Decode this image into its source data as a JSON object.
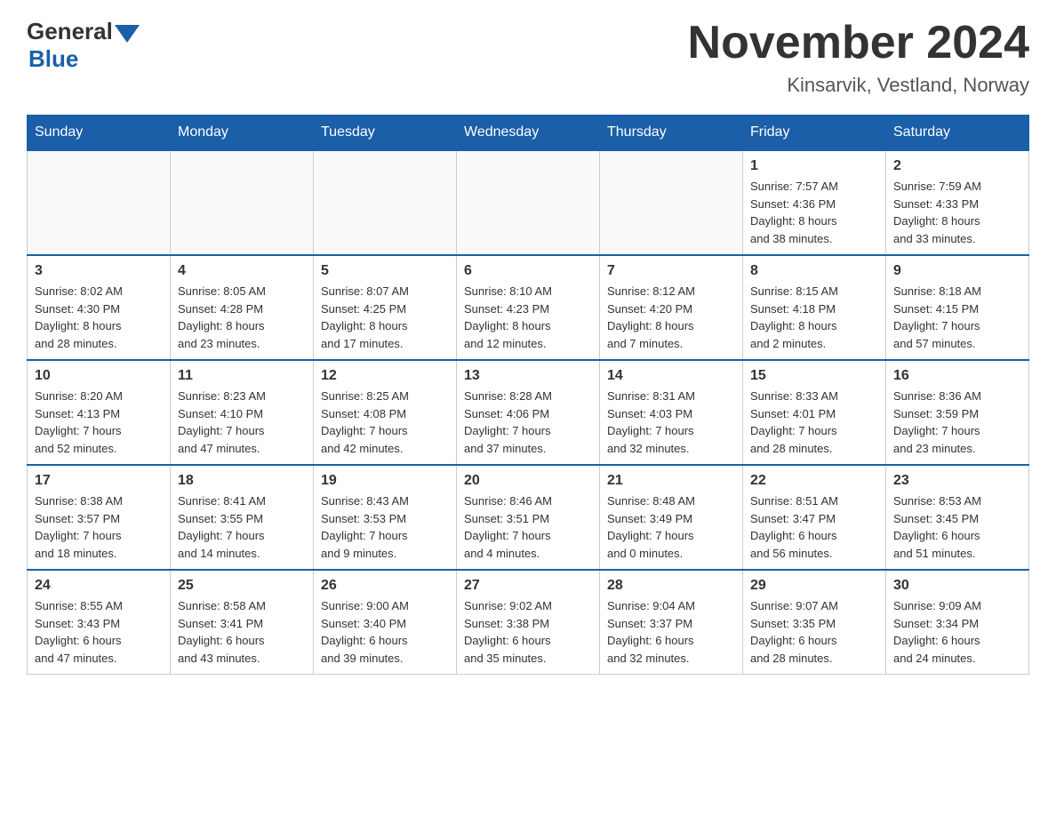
{
  "header": {
    "logo_text_general": "General",
    "logo_text_blue": "Blue",
    "calendar_title": "November 2024",
    "calendar_subtitle": "Kinsarvik, Vestland, Norway"
  },
  "days_of_week": [
    "Sunday",
    "Monday",
    "Tuesday",
    "Wednesday",
    "Thursday",
    "Friday",
    "Saturday"
  ],
  "weeks": [
    [
      {
        "day": "",
        "info": ""
      },
      {
        "day": "",
        "info": ""
      },
      {
        "day": "",
        "info": ""
      },
      {
        "day": "",
        "info": ""
      },
      {
        "day": "",
        "info": ""
      },
      {
        "day": "1",
        "info": "Sunrise: 7:57 AM\nSunset: 4:36 PM\nDaylight: 8 hours\nand 38 minutes."
      },
      {
        "day": "2",
        "info": "Sunrise: 7:59 AM\nSunset: 4:33 PM\nDaylight: 8 hours\nand 33 minutes."
      }
    ],
    [
      {
        "day": "3",
        "info": "Sunrise: 8:02 AM\nSunset: 4:30 PM\nDaylight: 8 hours\nand 28 minutes."
      },
      {
        "day": "4",
        "info": "Sunrise: 8:05 AM\nSunset: 4:28 PM\nDaylight: 8 hours\nand 23 minutes."
      },
      {
        "day": "5",
        "info": "Sunrise: 8:07 AM\nSunset: 4:25 PM\nDaylight: 8 hours\nand 17 minutes."
      },
      {
        "day": "6",
        "info": "Sunrise: 8:10 AM\nSunset: 4:23 PM\nDaylight: 8 hours\nand 12 minutes."
      },
      {
        "day": "7",
        "info": "Sunrise: 8:12 AM\nSunset: 4:20 PM\nDaylight: 8 hours\nand 7 minutes."
      },
      {
        "day": "8",
        "info": "Sunrise: 8:15 AM\nSunset: 4:18 PM\nDaylight: 8 hours\nand 2 minutes."
      },
      {
        "day": "9",
        "info": "Sunrise: 8:18 AM\nSunset: 4:15 PM\nDaylight: 7 hours\nand 57 minutes."
      }
    ],
    [
      {
        "day": "10",
        "info": "Sunrise: 8:20 AM\nSunset: 4:13 PM\nDaylight: 7 hours\nand 52 minutes."
      },
      {
        "day": "11",
        "info": "Sunrise: 8:23 AM\nSunset: 4:10 PM\nDaylight: 7 hours\nand 47 minutes."
      },
      {
        "day": "12",
        "info": "Sunrise: 8:25 AM\nSunset: 4:08 PM\nDaylight: 7 hours\nand 42 minutes."
      },
      {
        "day": "13",
        "info": "Sunrise: 8:28 AM\nSunset: 4:06 PM\nDaylight: 7 hours\nand 37 minutes."
      },
      {
        "day": "14",
        "info": "Sunrise: 8:31 AM\nSunset: 4:03 PM\nDaylight: 7 hours\nand 32 minutes."
      },
      {
        "day": "15",
        "info": "Sunrise: 8:33 AM\nSunset: 4:01 PM\nDaylight: 7 hours\nand 28 minutes."
      },
      {
        "day": "16",
        "info": "Sunrise: 8:36 AM\nSunset: 3:59 PM\nDaylight: 7 hours\nand 23 minutes."
      }
    ],
    [
      {
        "day": "17",
        "info": "Sunrise: 8:38 AM\nSunset: 3:57 PM\nDaylight: 7 hours\nand 18 minutes."
      },
      {
        "day": "18",
        "info": "Sunrise: 8:41 AM\nSunset: 3:55 PM\nDaylight: 7 hours\nand 14 minutes."
      },
      {
        "day": "19",
        "info": "Sunrise: 8:43 AM\nSunset: 3:53 PM\nDaylight: 7 hours\nand 9 minutes."
      },
      {
        "day": "20",
        "info": "Sunrise: 8:46 AM\nSunset: 3:51 PM\nDaylight: 7 hours\nand 4 minutes."
      },
      {
        "day": "21",
        "info": "Sunrise: 8:48 AM\nSunset: 3:49 PM\nDaylight: 7 hours\nand 0 minutes."
      },
      {
        "day": "22",
        "info": "Sunrise: 8:51 AM\nSunset: 3:47 PM\nDaylight: 6 hours\nand 56 minutes."
      },
      {
        "day": "23",
        "info": "Sunrise: 8:53 AM\nSunset: 3:45 PM\nDaylight: 6 hours\nand 51 minutes."
      }
    ],
    [
      {
        "day": "24",
        "info": "Sunrise: 8:55 AM\nSunset: 3:43 PM\nDaylight: 6 hours\nand 47 minutes."
      },
      {
        "day": "25",
        "info": "Sunrise: 8:58 AM\nSunset: 3:41 PM\nDaylight: 6 hours\nand 43 minutes."
      },
      {
        "day": "26",
        "info": "Sunrise: 9:00 AM\nSunset: 3:40 PM\nDaylight: 6 hours\nand 39 minutes."
      },
      {
        "day": "27",
        "info": "Sunrise: 9:02 AM\nSunset: 3:38 PM\nDaylight: 6 hours\nand 35 minutes."
      },
      {
        "day": "28",
        "info": "Sunrise: 9:04 AM\nSunset: 3:37 PM\nDaylight: 6 hours\nand 32 minutes."
      },
      {
        "day": "29",
        "info": "Sunrise: 9:07 AM\nSunset: 3:35 PM\nDaylight: 6 hours\nand 28 minutes."
      },
      {
        "day": "30",
        "info": "Sunrise: 9:09 AM\nSunset: 3:34 PM\nDaylight: 6 hours\nand 24 minutes."
      }
    ]
  ]
}
